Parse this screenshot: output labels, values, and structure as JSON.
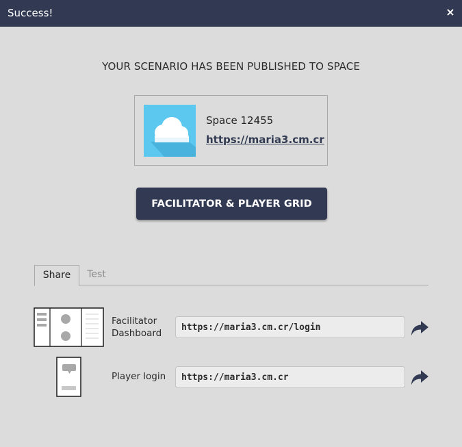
{
  "dialog": {
    "title": "Success!",
    "close_symbol": "×"
  },
  "main": {
    "heading": "YOUR SCENARIO HAS BEEN PUBLISHED TO SPACE",
    "space": {
      "name": "Space 12455",
      "link": "https://maria3.cm.cr",
      "thumbnail_icon": "cloud-icon"
    },
    "grid_button_label": "FACILITATOR & PLAYER GRID"
  },
  "tabs": [
    {
      "label": "Share",
      "active": true
    },
    {
      "label": "Test",
      "active": false
    }
  ],
  "share_rows": [
    {
      "label_line1": "Facilitator",
      "label_line2": "Dashboard",
      "url": "https://maria3.cm.cr/login",
      "icon": "dashboard-layout-icon"
    },
    {
      "label_line1": "Player login",
      "url": "https://maria3.cm.cr",
      "icon": "player-device-icon"
    }
  ],
  "colors": {
    "titlebar": "#313a52",
    "button": "#313a52",
    "background": "#dcdcdc",
    "thumbnail": "#5cc8f0"
  }
}
